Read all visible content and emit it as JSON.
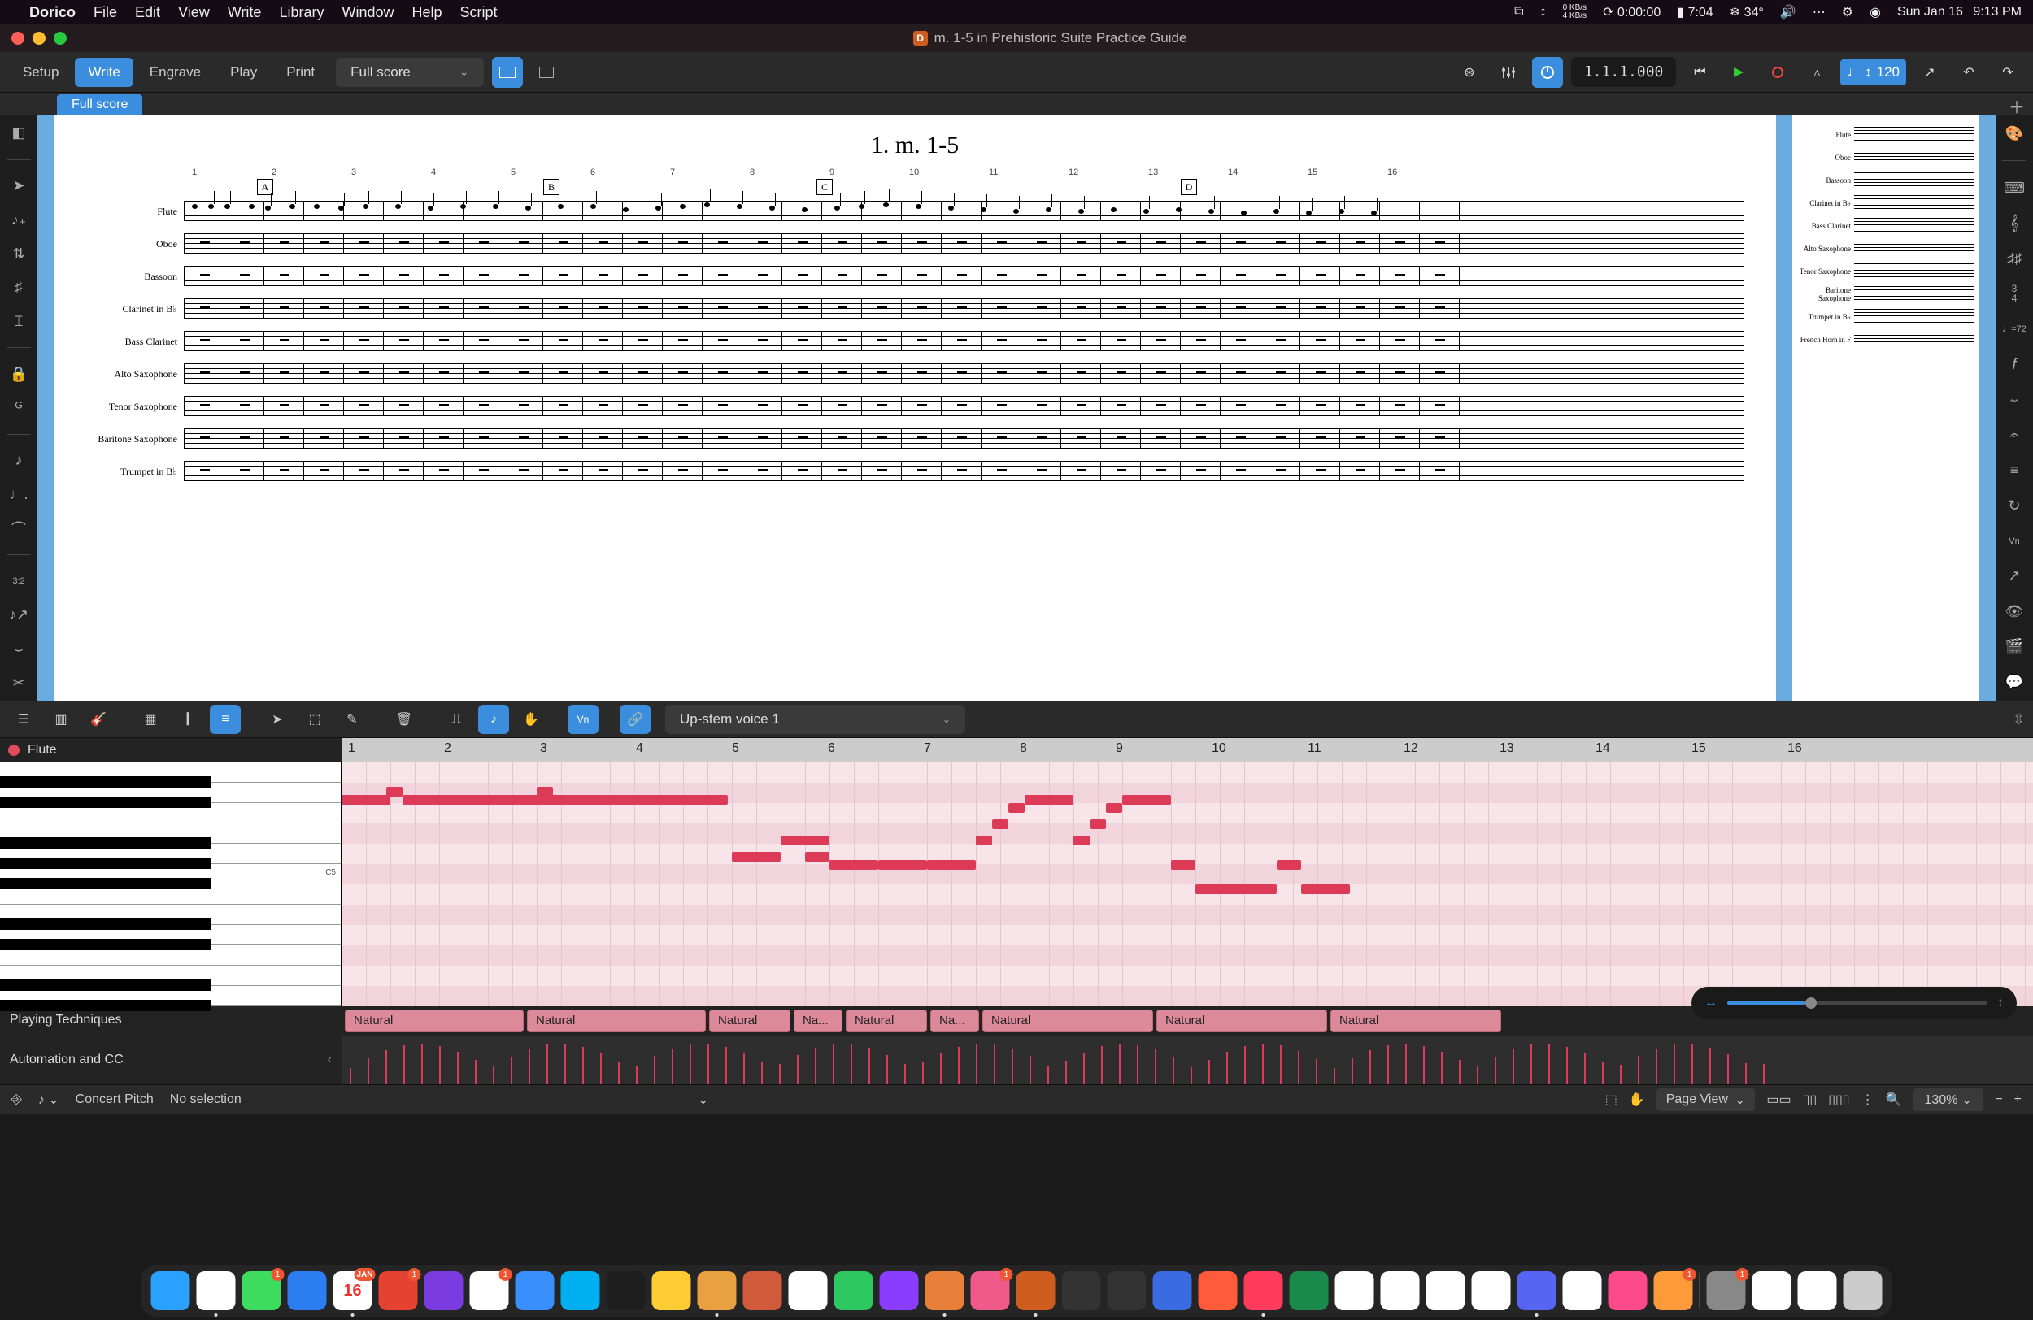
{
  "menubar": {
    "app": "Dorico",
    "items": [
      "File",
      "Edit",
      "View",
      "Write",
      "Library",
      "Window",
      "Help",
      "Script"
    ],
    "net_up": "0 KB/s",
    "net_down": "4 KB/s",
    "timer": "0:00:00",
    "battery": "7:04",
    "temp": "34°",
    "date": "Sun Jan 16",
    "time": "9:13 PM"
  },
  "window": {
    "title": "m. 1-5 in Prehistoric Suite Practice Guide",
    "traffic": [
      "#ff5f57",
      "#febc2e",
      "#28c840"
    ]
  },
  "toolbar": {
    "modes": [
      "Setup",
      "Write",
      "Engrave",
      "Play",
      "Print"
    ],
    "active_mode": "Write",
    "layout": "Full score",
    "transport_pos": "1.1.1.000",
    "tempo_label": "120"
  },
  "tabstrip": {
    "tabs": [
      "Full score"
    ]
  },
  "score": {
    "title": "1. m. 1-5",
    "bar_numbers": [
      "1",
      "2",
      "3",
      "4",
      "5",
      "6",
      "7",
      "8",
      "9",
      "10",
      "11",
      "12",
      "13",
      "14",
      "15",
      "16"
    ],
    "rehearsal_marks": [
      {
        "label": "A",
        "pos": 5
      },
      {
        "label": "B",
        "pos": 27
      },
      {
        "label": "C",
        "pos": 48
      },
      {
        "label": "D",
        "pos": 76
      }
    ],
    "instruments": [
      "Flute",
      "Oboe",
      "Bassoon",
      "Clarinet in B♭",
      "Bass Clarinet",
      "Alto Saxophone",
      "Tenor Saxophone",
      "Baritone Saxophone",
      "Trumpet in B♭"
    ],
    "page2_instruments": [
      "Flute",
      "Oboe",
      "Bassoon",
      "Clarinet in B♭",
      "Bass Clarinet",
      "Alto Saxophone",
      "Tenor Saxophone",
      "Baritone Saxophone",
      "Trumpet in B♭",
      "French Horn in F"
    ]
  },
  "keyeditor": {
    "voice": "Up-stem voice 1",
    "track": "Flute",
    "bar_numbers": [
      "1",
      "2",
      "3",
      "4",
      "5",
      "6",
      "7",
      "8",
      "9",
      "10",
      "11",
      "12",
      "13",
      "14",
      "15",
      "16"
    ],
    "middle_c": "C5",
    "pt_label": "Playing Techniques",
    "pt_cells": [
      "Natural",
      "Natural",
      "Natural",
      "Na...",
      "Natural",
      "Na...",
      "Natural",
      "Natural",
      "Natural"
    ],
    "cc_label": "Automation and CC"
  },
  "statusbar": {
    "pitch": "Concert Pitch",
    "selection": "No selection",
    "view": "Page View",
    "zoom": "130%"
  },
  "dock": {
    "icons": [
      {
        "name": "finder",
        "color": "#2aa0ff"
      },
      {
        "name": "chrome",
        "color": "#fff"
      },
      {
        "name": "messages",
        "color": "#3ddc5e",
        "badge": "1"
      },
      {
        "name": "auth",
        "color": "#2c7ef0"
      },
      {
        "name": "calendar",
        "color": "#fff",
        "text": "16",
        "badge": "JAN"
      },
      {
        "name": "todoist",
        "color": "#e44332",
        "badge": "1"
      },
      {
        "name": "omni",
        "color": "#7a3be0"
      },
      {
        "name": "notes",
        "color": "#fff",
        "badge": "1"
      },
      {
        "name": "things",
        "color": "#3a8fff"
      },
      {
        "name": "skype",
        "color": "#00aff0"
      },
      {
        "name": "figma",
        "color": "#1e1e1e"
      },
      {
        "name": "paste",
        "color": "#ffcc33"
      },
      {
        "name": "affinity",
        "color": "#e8a040"
      },
      {
        "name": "bear",
        "color": "#d15a3a"
      },
      {
        "name": "notion",
        "color": "#fff"
      },
      {
        "name": "numbers",
        "color": "#2dc960"
      },
      {
        "name": "dash",
        "color": "#8a3cff"
      },
      {
        "name": "soulver",
        "color": "#e8803a"
      },
      {
        "name": "craft",
        "color": "#f05a8a",
        "badge": "1"
      },
      {
        "name": "dorico",
        "color": "#cf5d1f"
      },
      {
        "name": "slack2",
        "color": "#333"
      },
      {
        "name": "reeder",
        "color": "#333"
      },
      {
        "name": "shortcuts",
        "color": "#3b6be0"
      },
      {
        "name": "raycast",
        "color": "#ff5a3a"
      },
      {
        "name": "music",
        "color": "#ff3a5a"
      },
      {
        "name": "excel",
        "color": "#1a8a4a"
      },
      {
        "name": "panda1",
        "color": "#fff"
      },
      {
        "name": "panda2",
        "color": "#fff"
      },
      {
        "name": "reddit",
        "color": "#fff"
      },
      {
        "name": "alp",
        "color": "#fff"
      },
      {
        "name": "discord",
        "color": "#5865f2"
      },
      {
        "name": "slack",
        "color": "#fff"
      },
      {
        "name": "shortcuts2",
        "color": "#ff4a8a"
      },
      {
        "name": "home",
        "color": "#ff9a3a",
        "badge": "1"
      },
      {
        "name": "settings",
        "color": "#888",
        "badge": "1"
      },
      {
        "name": "font",
        "color": "#fff"
      },
      {
        "name": "textedit",
        "color": "#fff"
      },
      {
        "name": "trash",
        "color": "#ccc"
      }
    ]
  }
}
